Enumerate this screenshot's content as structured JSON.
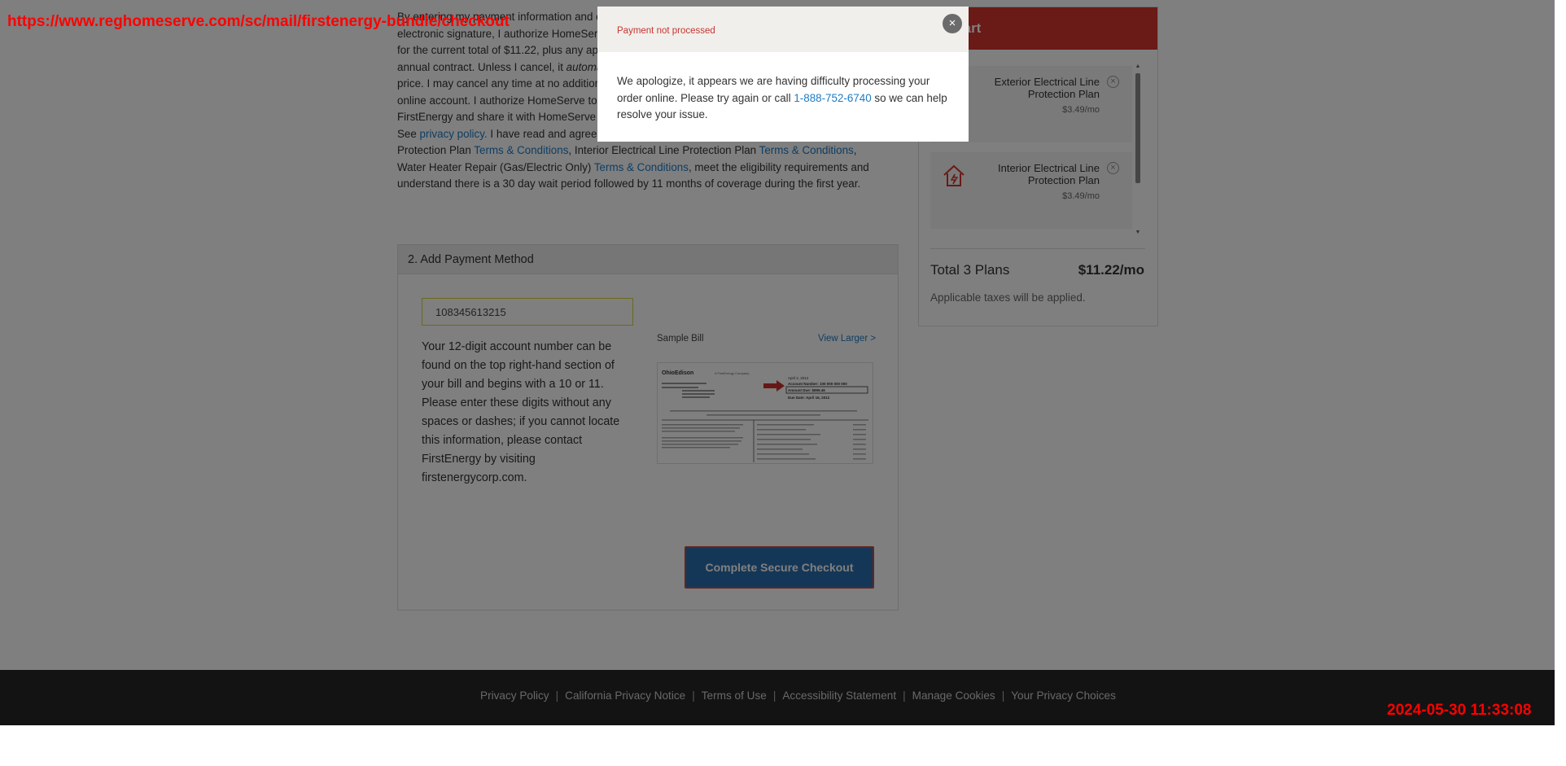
{
  "consent": {
    "seg1": "By entering my payment information and clicking Complete Secure Checkout, which I intend to be my electronic signature, I authorize HomeServe USA Repair Management Corp. to charge my account for the current total of $11.22, plus any applicable taxes, at the billing frequency selected, as an annual contract. Unless I cancel, it ",
    "seg1_bold": "an annual contract. Unless I cancel, it",
    "seg1_italic": "automatically renews",
    "seg2": "and frequency at the then current renewal price. I may cancel any time at no additional cost, without obligation, by calling or by visiting my online account. I authorize HomeServe to request my data, including my account number, from FirstEnergy and share it with HomeServe USA Repair Management Corp. (\"HomeServe\"). Your Data: See ",
    "privacy_link": "privacy policy.",
    "seg3": " I have read and agree to the Terms & Conditions for Exterior Electrical Line Protection Plan ",
    "terms_link": "Terms & Conditions",
    "seg4": ", Interior Electrical Line Protection Plan ",
    "seg5": ", Water Heater Repair (Gas/Electric Only) ",
    "seg6": ", meet the eligibility requirements and understand there is a 30 day wait period followed by 11 months of coverage during the first year."
  },
  "payment": {
    "header": "2. Add Payment Method",
    "account_value": "108345613215",
    "help": "Your 12-digit account number can be found on the top right-hand section of your bill and begins with a 10 or 11. Please enter these digits without any spaces or dashes; if you cannot locate this information, please contact FirstEnergy by visiting firstenergycorp.com.",
    "sample_label": "Sample Bill",
    "view_larger": "View Larger >",
    "checkout_label": "Complete Secure Checkout"
  },
  "sample_bill": {
    "brand": "OhioEdison",
    "tagline": "A FirstEnergy Company",
    "date": "April 2, 2012",
    "account_number": "Account Number: 100 000 000 000",
    "amount_due": "Amount Due: $899.46",
    "due_date": "Due Date:   April 16, 2012"
  },
  "cart": {
    "header": "My Cart",
    "items": [
      {
        "name": "Exterior Electrical Line Protection Plan",
        "price": "$3.49/mo"
      },
      {
        "name": "Interior Electrical Line Protection Plan",
        "price": "$3.49/mo"
      }
    ],
    "total_label": "Total 3 Plans",
    "total_value": "$11.22/mo",
    "taxes_note": "Applicable taxes will be applied."
  },
  "modal": {
    "title": "Payment not processed",
    "body_before": "We apologize, it appears we are having difficulty processing your order online. Please try again or call ",
    "phone": "1-888-752-6740",
    "body_after": " so we can help resolve your issue.",
    "close": "×"
  },
  "footer": {
    "links": [
      "Privacy Policy",
      "California Privacy Notice",
      "Terms of Use",
      "Accessibility Statement",
      "Manage Cookies",
      "Your Privacy Choices"
    ],
    "separator": "|"
  },
  "stamps": {
    "url": "https://www.reghomeserve.com/sc/mail/firstenergy-bundle/checkout",
    "timestamp": "2024-05-30 11:33:08"
  },
  "colors": {
    "brand_red": "#d5352e",
    "link_blue": "#1e7bc4",
    "checkout_blue": "#2b6fae",
    "footer_bg": "#262626"
  }
}
